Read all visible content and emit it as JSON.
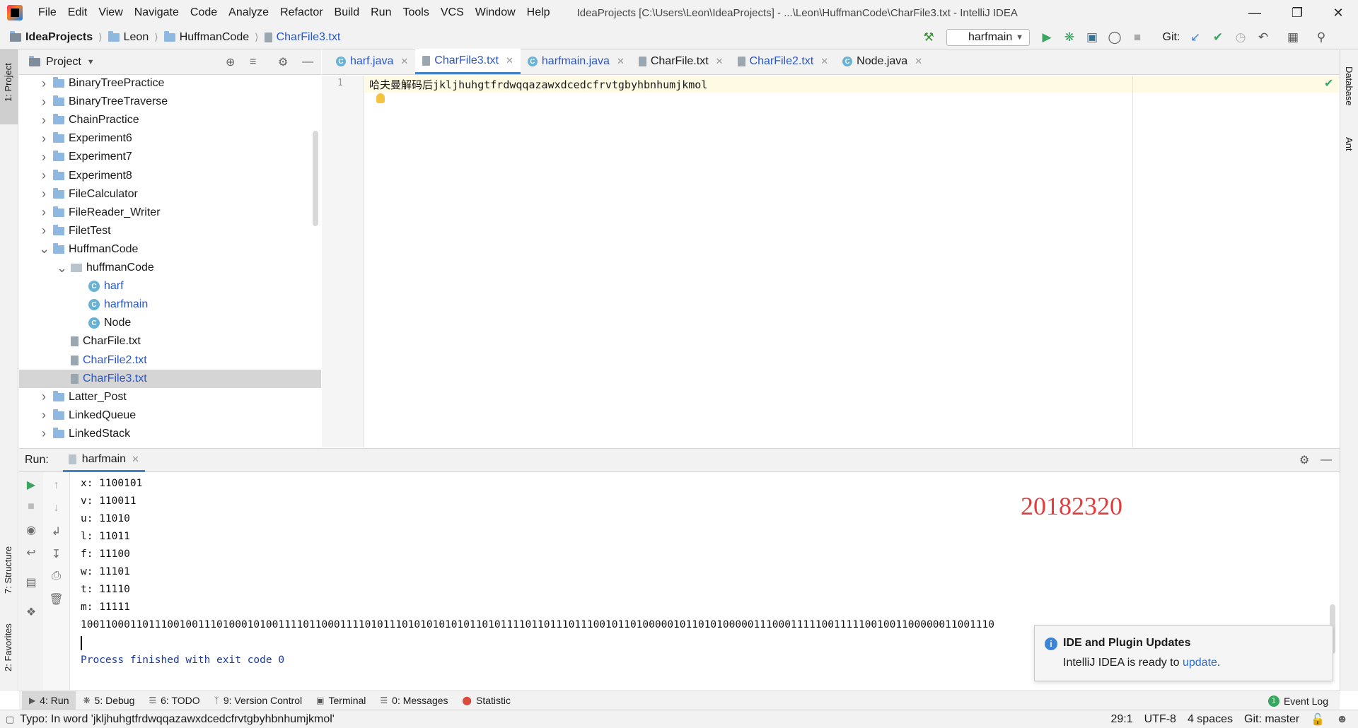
{
  "window": {
    "menu": [
      "File",
      "Edit",
      "View",
      "Navigate",
      "Code",
      "Analyze",
      "Refactor",
      "Build",
      "Run",
      "Tools",
      "VCS",
      "Window",
      "Help"
    ],
    "title": "IdeaProjects [C:\\Users\\Leon\\IdeaProjects] - ...\\Leon\\HuffmanCode\\CharFile3.txt - IntelliJ IDEA"
  },
  "navbar": {
    "breadcrumbs": [
      "IdeaProjects",
      "Leon",
      "HuffmanCode",
      "CharFile3.txt"
    ],
    "run_config": "harfmain",
    "git_label": "Git:"
  },
  "left_strip": {
    "project": "1: Project",
    "structure": "7: Structure",
    "favorites": "2: Favorites"
  },
  "right_strip": {
    "database": "Database",
    "ant": "Ant"
  },
  "project_panel": {
    "title": "Project",
    "tree": [
      {
        "label": "BinaryTreePractice",
        "type": "folder",
        "depth": 0,
        "expanded": false
      },
      {
        "label": "BinaryTreeTraverse",
        "type": "folder",
        "depth": 0,
        "expanded": false
      },
      {
        "label": "ChainPractice",
        "type": "folder",
        "depth": 0,
        "expanded": false
      },
      {
        "label": "Experiment6",
        "type": "folder",
        "depth": 0,
        "expanded": false
      },
      {
        "label": "Experiment7",
        "type": "folder",
        "depth": 0,
        "expanded": false
      },
      {
        "label": "Experiment8",
        "type": "folder",
        "depth": 0,
        "expanded": false
      },
      {
        "label": "FileCalculator",
        "type": "folder",
        "depth": 0,
        "expanded": false
      },
      {
        "label": "FileReader_Writer",
        "type": "folder",
        "depth": 0,
        "expanded": false
      },
      {
        "label": "FiletTest",
        "type": "folder",
        "depth": 0,
        "expanded": false
      },
      {
        "label": "HuffmanCode",
        "type": "folder",
        "depth": 0,
        "expanded": true
      },
      {
        "label": "huffmanCode",
        "type": "package",
        "depth": 1,
        "expanded": true
      },
      {
        "label": "harf",
        "type": "class",
        "depth": 2
      },
      {
        "label": "harfmain",
        "type": "class",
        "depth": 2
      },
      {
        "label": "Node",
        "type": "class",
        "depth": 2
      },
      {
        "label": "CharFile.txt",
        "type": "file",
        "depth": 1
      },
      {
        "label": "CharFile2.txt",
        "type": "file",
        "depth": 1
      },
      {
        "label": "CharFile3.txt",
        "type": "file",
        "depth": 1,
        "selected": true
      },
      {
        "label": "Latter_Post",
        "type": "folder",
        "depth": 0,
        "expanded": false
      },
      {
        "label": "LinkedQueue",
        "type": "folder",
        "depth": 0,
        "expanded": false
      },
      {
        "label": "LinkedStack",
        "type": "folder",
        "depth": 0,
        "expanded": false
      }
    ]
  },
  "editor": {
    "tabs": [
      {
        "label": "harf.java",
        "icon": "class-icon"
      },
      {
        "label": "CharFile3.txt",
        "icon": "text-file-icon",
        "active": true
      },
      {
        "label": "harfmain.java",
        "icon": "class-icon"
      },
      {
        "label": "CharFile.txt",
        "icon": "text-file-icon"
      },
      {
        "label": "CharFile2.txt",
        "icon": "text-file-icon"
      },
      {
        "label": "Node.java",
        "icon": "class-icon"
      }
    ],
    "line_number": "1",
    "content": "哈夫曼解码后jkljhuhgtfrdwqqazawxdcedcfrvtgbyhbnhumjkmol"
  },
  "run_panel": {
    "label": "Run:",
    "tab": "harfmain",
    "console_lines": [
      "x: 1100101",
      "v: 110011",
      "u: 11010",
      "l: 11011",
      "f: 11100",
      "w: 11101",
      "t: 11110",
      "m: 11111",
      "1001100011011100100111010001010011110110001111010111010101010101101011110110111011100101101000001011010100000111000111110011111001001100000011001110"
    ],
    "process_line": "Process finished with exit code 0",
    "watermark": "20182320"
  },
  "notification": {
    "title": "IDE and Plugin Updates",
    "body": "IntelliJ IDEA is ready to",
    "link": "update",
    "suffix": "."
  },
  "toolwindows": {
    "run": "4: Run",
    "debug": "5: Debug",
    "todo": "6: TODO",
    "vcs": "9: Version Control",
    "terminal": "Terminal",
    "messages": "0: Messages",
    "statistic": "Statistic",
    "event_log": "Event Log",
    "event_count": "1"
  },
  "statusbar": {
    "message": "Typo: In word 'jkljhuhgtfrdwqqazawxdcedcfrvtgbyhbnhumjkmol'",
    "position": "29:1",
    "encoding": "UTF-8",
    "indent": "4 spaces",
    "git_branch": "Git: master"
  }
}
